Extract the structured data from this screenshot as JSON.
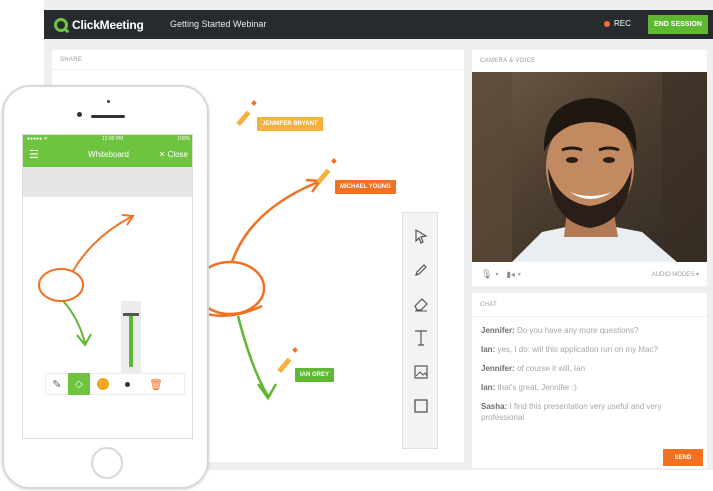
{
  "app": {
    "logo_text": "ClickMeeting",
    "event_title": "Getting Started Webinar",
    "rec_label": "REC",
    "end_button": "END SESSION"
  },
  "share": {
    "label": "SHARE"
  },
  "camera": {
    "label": "CAMERA & VOICE",
    "audio_modes": "AUDIO MODES"
  },
  "annotations": [
    "JENNIFER BRYANT",
    "MICHAEL YOUNG",
    "IAN GREY"
  ],
  "chat": {
    "label": "CHAT",
    "messages": [
      {
        "author": "Jennifer:",
        "text": " Do you have any more questions?"
      },
      {
        "author": "Ian:",
        "text": " yes, I do: will this application run on my Mac?"
      },
      {
        "author": "Jennifer:",
        "text": " of course it will, Ian"
      },
      {
        "author": "Ian:",
        "text": " that's great, Jennifer :)"
      },
      {
        "author": "Sasha:",
        "text": " I find this presentation very useful and very professional"
      }
    ],
    "send_button": "SEND"
  },
  "tools": [
    "select-tool",
    "pencil-tool",
    "eraser-tool",
    "text-tool",
    "image-tool",
    "rectangle-tool"
  ],
  "mobile": {
    "status_time": "12:00 PM",
    "status_carrier": "●●●●● ᯤ",
    "status_battery": "100%",
    "title": "Whiteboard",
    "close": "✕ Close"
  },
  "colors": {
    "green": "#6ec43f",
    "orange": "#f37021",
    "dark": "#272b30"
  }
}
